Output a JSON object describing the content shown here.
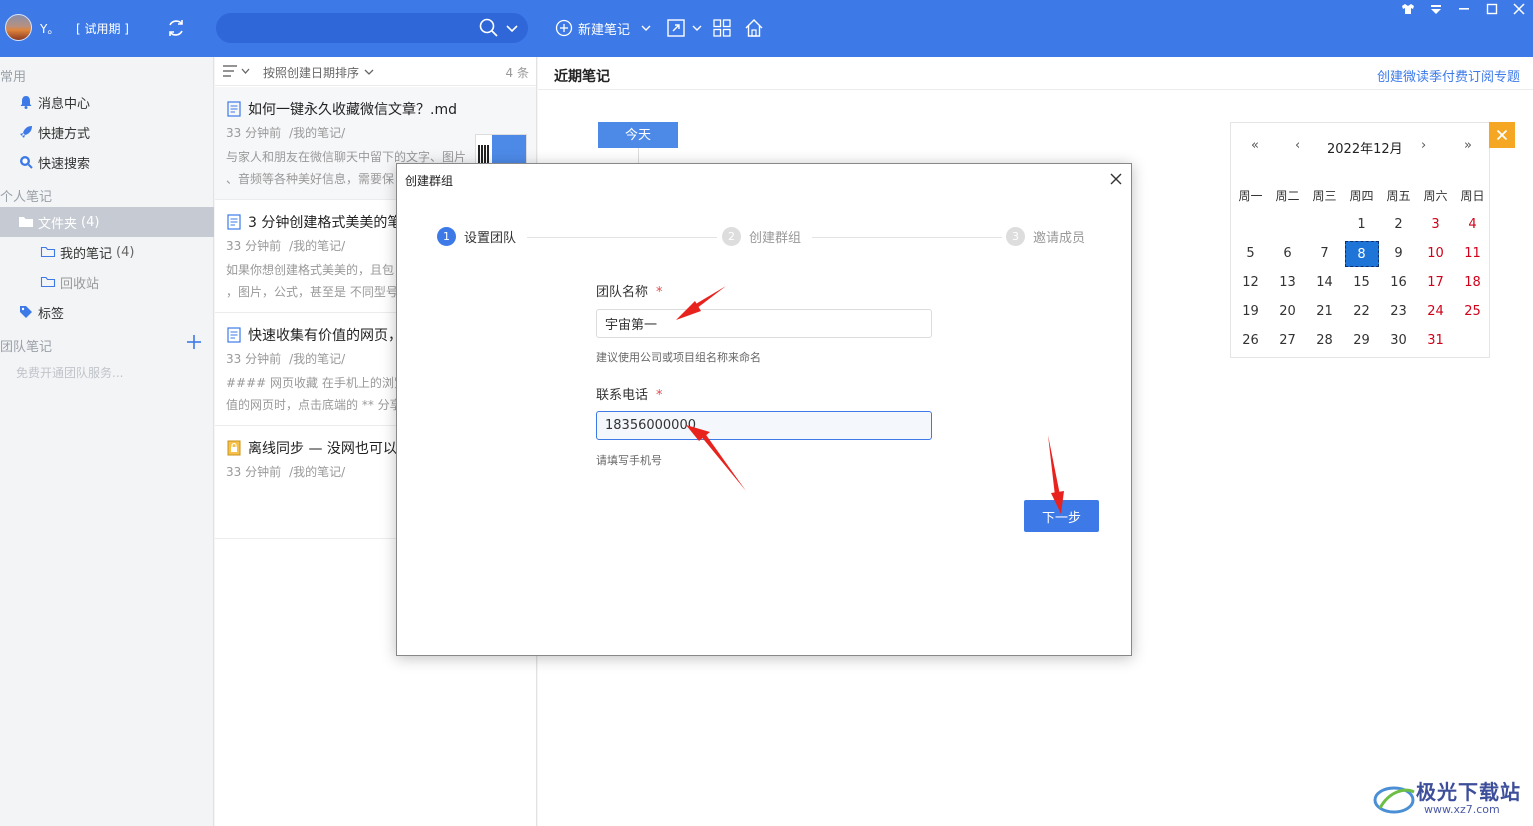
{
  "topbar": {
    "username": "Y。",
    "trial_label": "[ 试用期 ]",
    "search_placeholder": "",
    "new_note_label": "新建笔记"
  },
  "sidebar": {
    "section_common": "常用",
    "common_items": [
      {
        "label": "消息中心",
        "icon": "bell-icon"
      },
      {
        "label": "快捷方式",
        "icon": "rocket-icon"
      },
      {
        "label": "快速搜索",
        "icon": "search-icon"
      }
    ],
    "section_personal": "个人笔记",
    "folder": {
      "label": "文件夹",
      "count": "(4)"
    },
    "my_notes": {
      "label": "我的笔记",
      "count": "(4)"
    },
    "recycle": {
      "label": "回收站"
    },
    "tags": {
      "label": "标签"
    },
    "section_team": "团队笔记",
    "team_hint": "免费开通团队服务..."
  },
  "notelist": {
    "sort_label": "按照创建日期排序",
    "count_label": "4 条",
    "notes": [
      {
        "title": "如何一键永久收藏微信文章？.md",
        "time": "33 分钟前",
        "path": "/我的笔记/",
        "snippet1": "与家人和朋友在微信聊天中留下的文字、图片",
        "snippet2": "、音频等各种美好信息，需要保"
      },
      {
        "title": "3 分钟创建格式美美的笔",
        "time": "33 分钟前",
        "path": "/我的笔记/",
        "snippet1": "如果你想创建格式美美的，且包",
        "snippet2": "，图片，公式，甚至是 不同型号"
      },
      {
        "title": "快速收集有价值的网页，",
        "time": "33 分钟前",
        "path": "/我的笔记/",
        "snippet1": "#### 网页收藏 在手机上的浏览",
        "snippet2": "值的网页时，点击底端的 ** 分享"
      },
      {
        "title": "离线同步 — 没网也可以",
        "time": "33 分钟前",
        "path": "/我的笔记/",
        "snippet1": "",
        "snippet2": ""
      }
    ]
  },
  "main": {
    "title": "近期笔记",
    "link": "创建微读季付费订阅专题",
    "today_label": "今天"
  },
  "calendar": {
    "nav_prev_year": "«",
    "nav_prev_month": "‹",
    "month_label": "2022年12月",
    "nav_next_month": "›",
    "nav_next_year": "»",
    "weekdays": [
      "周一",
      "周二",
      "周三",
      "周四",
      "周五",
      "周六",
      "周日"
    ],
    "weeks": [
      [
        "",
        "",
        "",
        "1",
        "2",
        "3",
        "4"
      ],
      [
        "5",
        "6",
        "7",
        "8",
        "9",
        "10",
        "11"
      ],
      [
        "12",
        "13",
        "14",
        "15",
        "16",
        "17",
        "18"
      ],
      [
        "19",
        "20",
        "21",
        "22",
        "23",
        "24",
        "25"
      ],
      [
        "26",
        "27",
        "28",
        "29",
        "30",
        "31",
        ""
      ]
    ],
    "today": "8"
  },
  "modal": {
    "title": "创建群组",
    "steps": [
      {
        "num": "1",
        "label": "设置团队"
      },
      {
        "num": "2",
        "label": "创建群组"
      },
      {
        "num": "3",
        "label": "邀请成员"
      }
    ],
    "team_name_label": "团队名称",
    "required_mark": "*",
    "team_name_value": "宇宙第一",
    "team_name_hint": "建议使用公司或项目组名称来命名",
    "phone_label": "联系电话",
    "phone_value": "18356000000",
    "phone_hint": "请填写手机号",
    "next_label": "下一步"
  },
  "watermark": {
    "text": "极光下载站",
    "url": "www.xz7.com"
  },
  "colors": {
    "accent": "#3d7ae8",
    "weekend": "#d0021b",
    "arrow": "#e8231e",
    "close_badge": "#f5a623"
  }
}
